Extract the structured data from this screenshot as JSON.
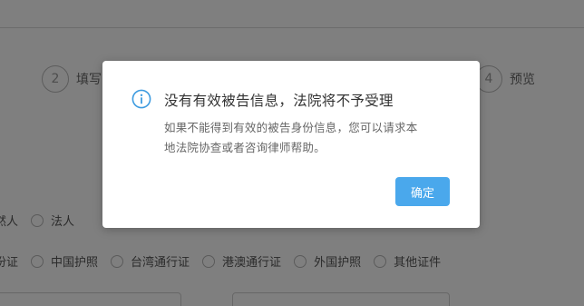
{
  "background": {
    "steps": [
      {
        "number": "2",
        "label": "填写"
      },
      {
        "number": "4",
        "label": "预览"
      }
    ],
    "party_type_options": [
      "然人",
      "法人"
    ],
    "id_type_options": [
      "份证",
      "中国护照",
      "台湾通行证",
      "港澳通行证",
      "外国护照",
      "其他证件"
    ]
  },
  "dialog": {
    "icon": "info-icon",
    "title": "没有有效被告信息，法院将不予受理",
    "content_line1": "如果不能得到有效的被告身份信息，您可以请求本",
    "content_line2": "地法院协查或者咨询律师帮助。",
    "ok_label": "确定"
  },
  "colors": {
    "accent": "#4aa8ec",
    "icon": "#3d9be0",
    "mask": "rgba(0,0,0,0.5)"
  }
}
